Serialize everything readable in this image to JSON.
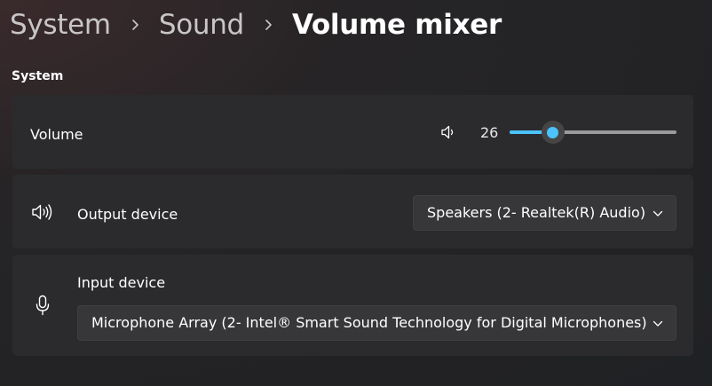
{
  "breadcrumb": {
    "items": [
      {
        "label": "System"
      },
      {
        "label": "Sound"
      },
      {
        "label": "Volume mixer"
      }
    ]
  },
  "section": {
    "title": "System"
  },
  "volume": {
    "label": "Volume",
    "icon": "speaker-icon",
    "value": "26",
    "percent": 26,
    "accent_color": "#4cc2ff"
  },
  "output": {
    "label": "Output device",
    "icon": "speaker-loud-icon",
    "selected": "Speakers (2- Realtek(R) Audio)"
  },
  "input": {
    "label": "Input device",
    "icon": "microphone-icon",
    "selected": "Microphone Array (2- Intel® Smart Sound Technology for Digital Microphones)"
  }
}
